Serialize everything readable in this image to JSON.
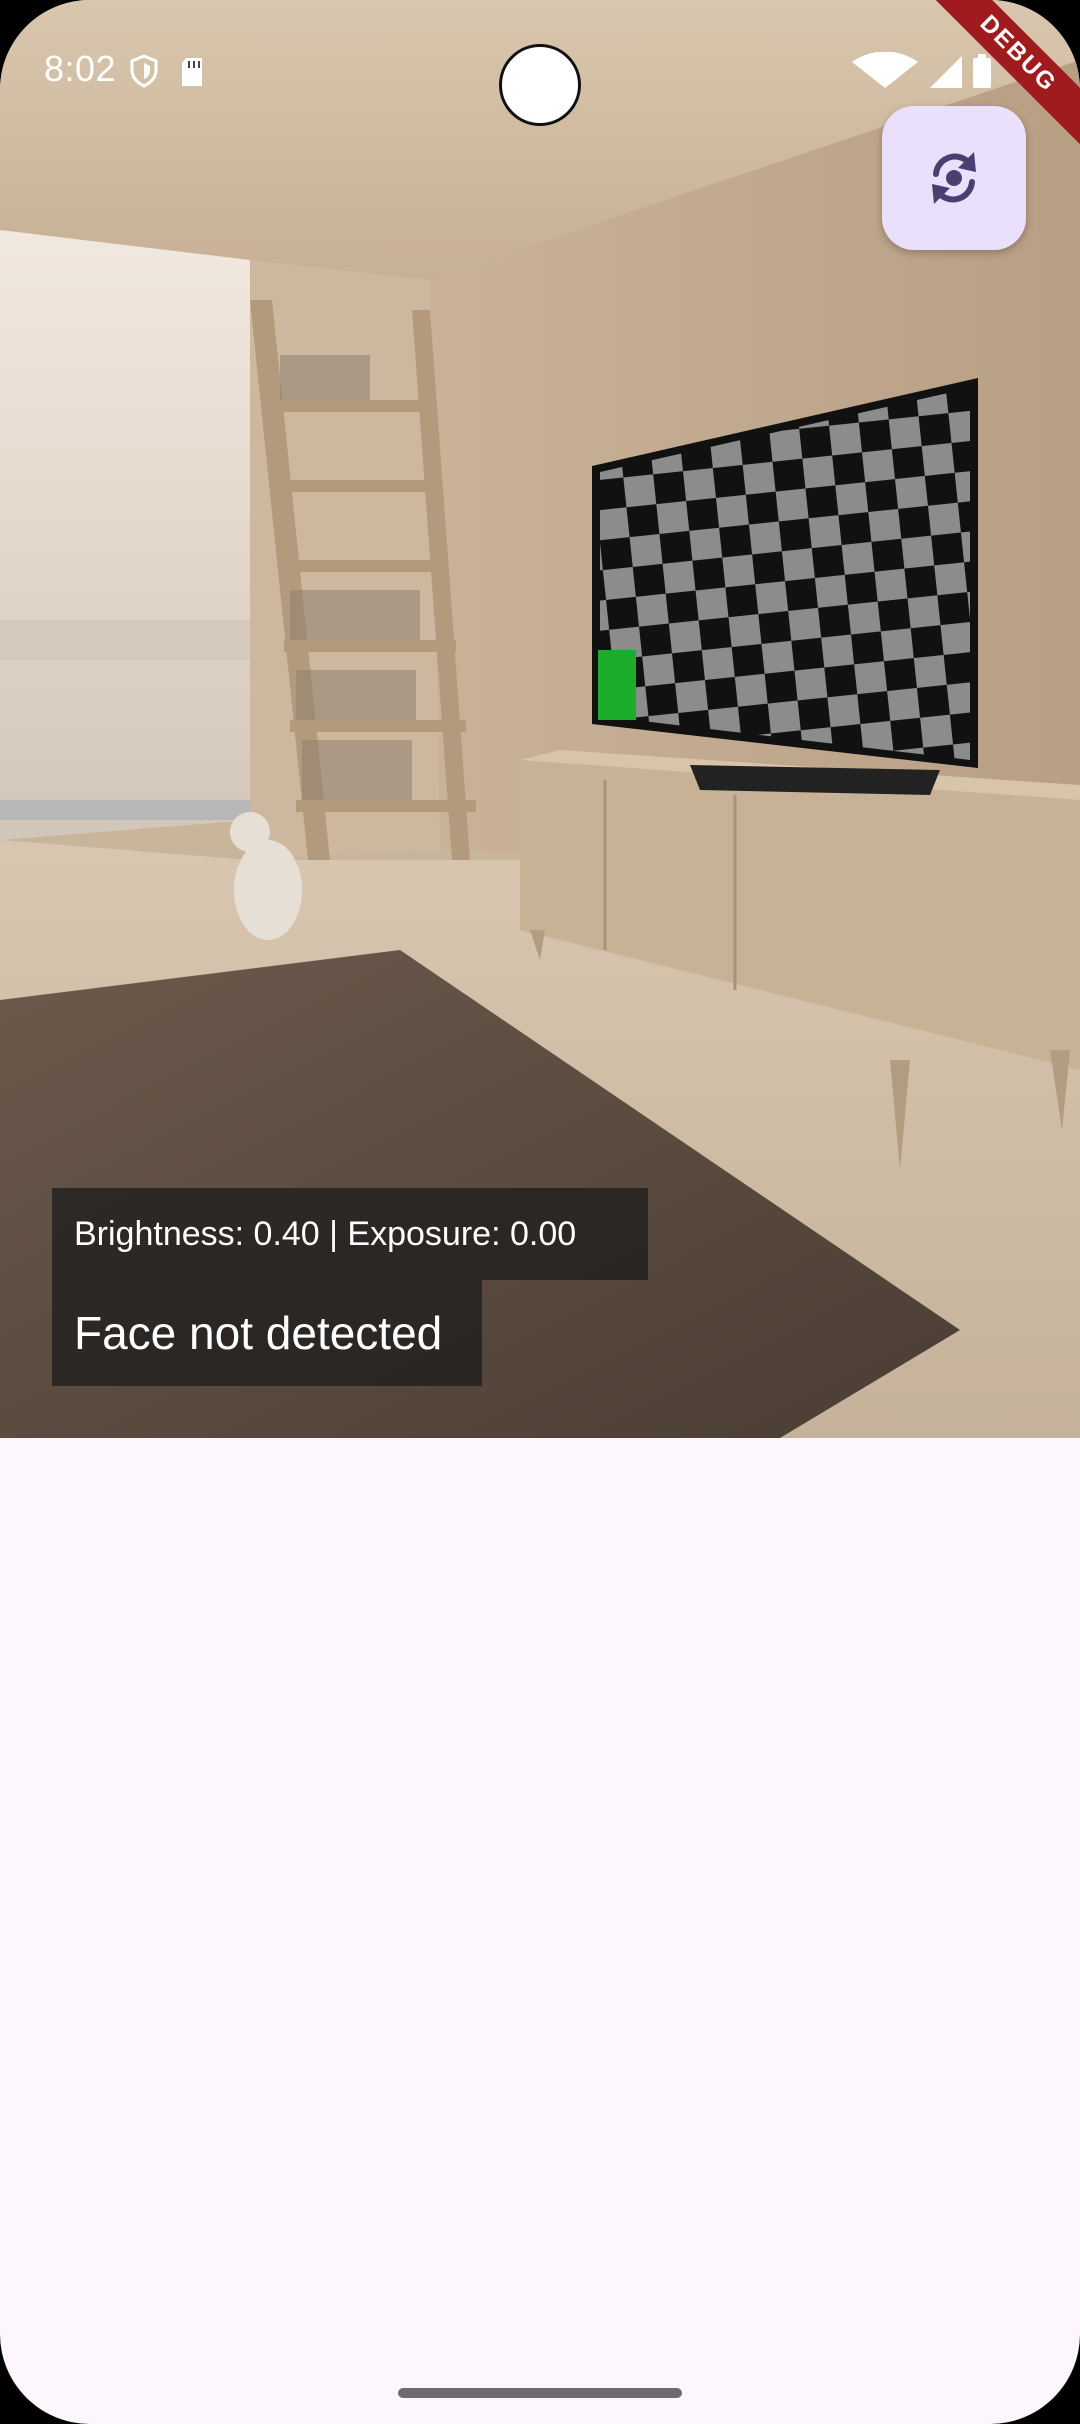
{
  "status_bar": {
    "time": "8:02",
    "left_icons": [
      "shield-icon",
      "sd-card-icon"
    ],
    "right_icons": [
      "wifi-icon",
      "signal-icon",
      "battery-icon"
    ]
  },
  "debug_banner": {
    "label": "DEBUG",
    "color": "#9f1b1e"
  },
  "fab": {
    "icon": "switch-camera-icon",
    "background": "#ebe0fb",
    "icon_color": "#4b3f72"
  },
  "overlay": {
    "brightness_text": "Brightness: 0.40 | Exposure: 0.00",
    "face_status": "Face not detected"
  },
  "colors": {
    "body_background": "#fdf6fc",
    "overlay_background": "#1e1e1e"
  }
}
